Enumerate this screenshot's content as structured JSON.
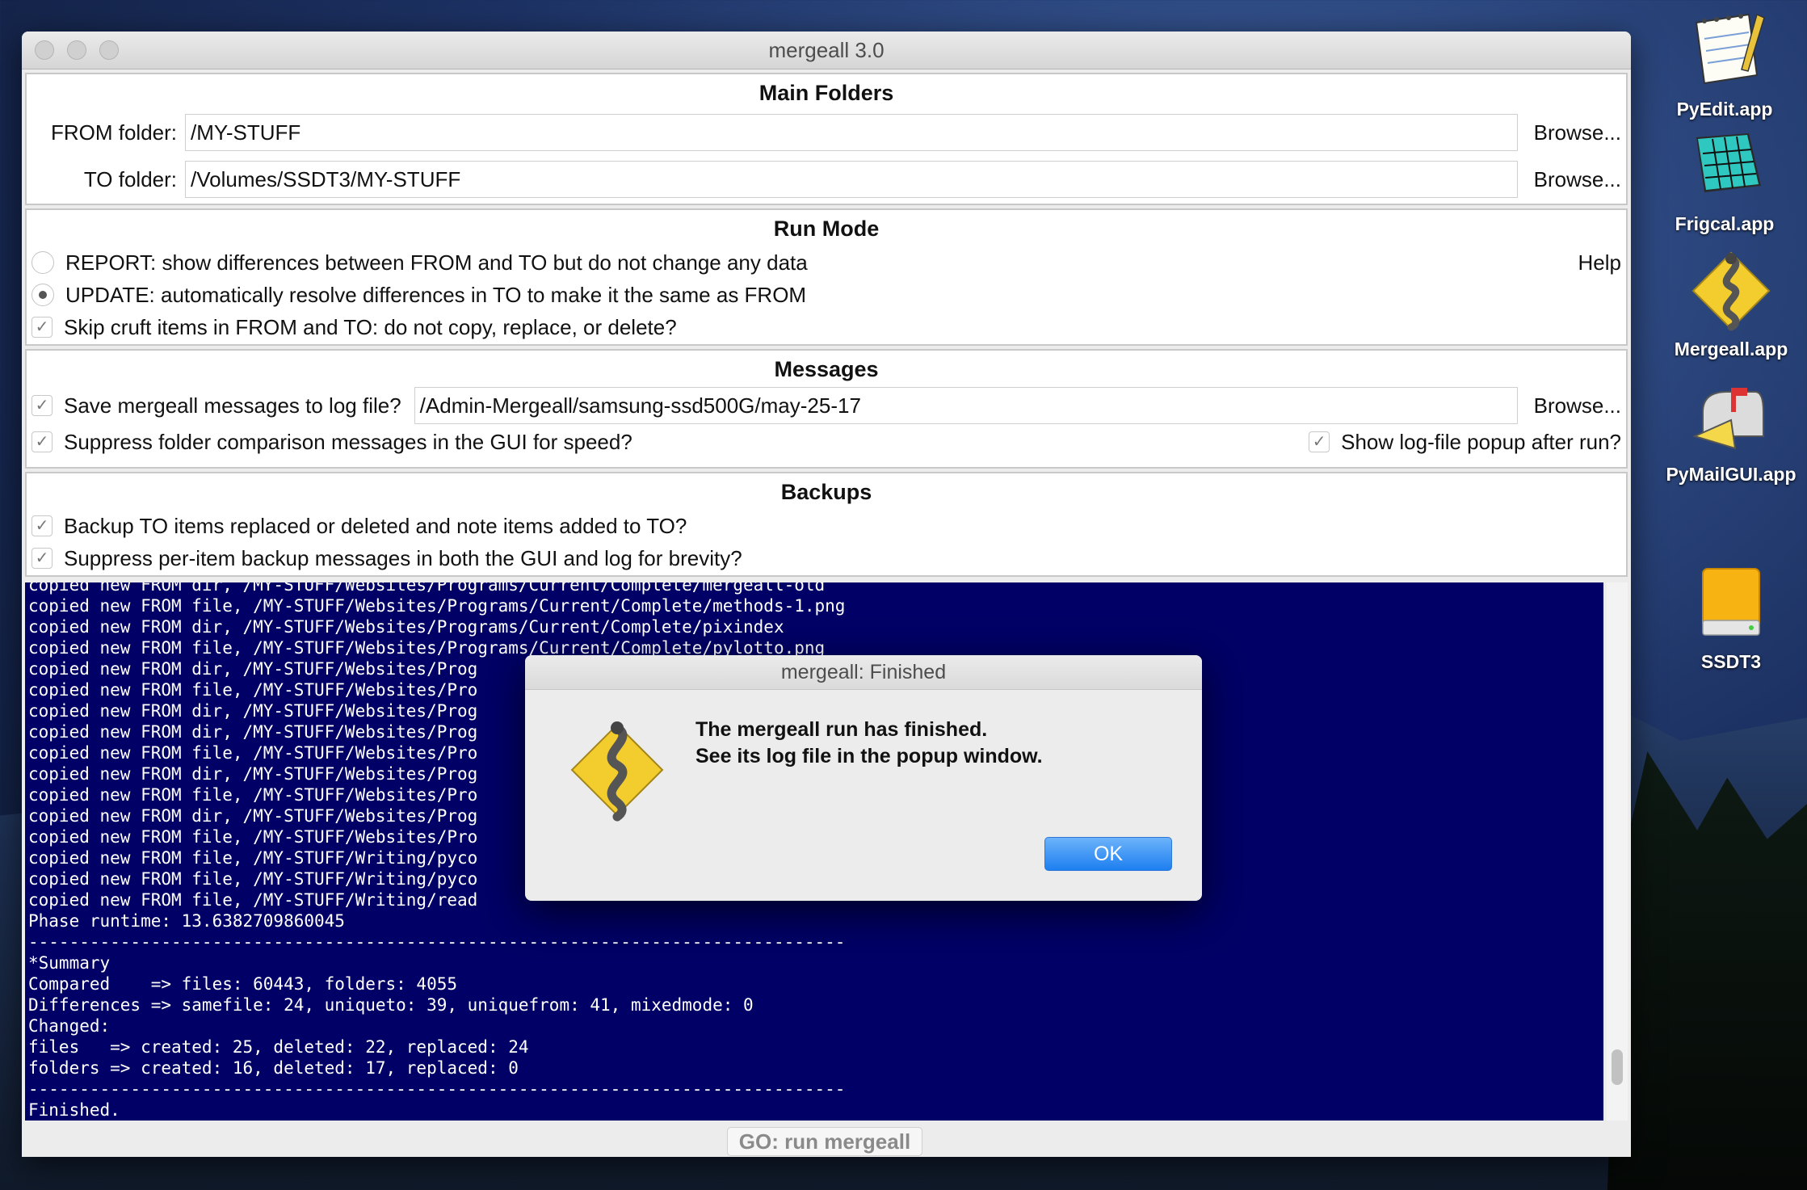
{
  "window": {
    "title": "mergeall 3.0",
    "main_folders": {
      "heading": "Main Folders",
      "from_label": "FROM folder:",
      "from_value": "/MY-STUFF",
      "to_label": "TO folder:",
      "to_value": "/Volumes/SSDT3/MY-STUFF",
      "browse_label": "Browse..."
    },
    "run_mode": {
      "heading": "Run Mode",
      "report_label": "REPORT: show differences between FROM and TO but do not change any data",
      "update_label": "UPDATE: automatically resolve differences in TO to make it the same as FROM",
      "skip_label": "Skip cruft items in FROM and TO: do not copy, replace, or delete?",
      "help_label": "Help",
      "selected": "UPDATE"
    },
    "messages": {
      "heading": "Messages",
      "save_log_label": "Save mergeall messages to log file?",
      "log_path": "/Admin-Mergeall/samsung-ssd500G/may-25-17",
      "browse_label": "Browse...",
      "suppress_label": "Suppress folder comparison messages in the GUI for speed?",
      "show_popup_label": "Show log-file popup after run?"
    },
    "backups": {
      "heading": "Backups",
      "backup_label": "Backup TO items replaced or deleted and note items added to TO?",
      "suppress_backup_label": "Suppress per-item backup messages in both the GUI and log for brevity?"
    },
    "log_lines": [
      "copied new FROM dir, /MY-STUFF/Websites/Programs/Current/Complete/mergeall-old",
      "copied new FROM file, /MY-STUFF/Websites/Programs/Current/Complete/methods-1.png",
      "copied new FROM dir, /MY-STUFF/Websites/Programs/Current/Complete/pixindex",
      "copied new FROM file, /MY-STUFF/Websites/Programs/Current/Complete/pylotto.png",
      "copied new FROM dir, /MY-STUFF/Websites/Prog",
      "copied new FROM file, /MY-STUFF/Websites/Pro",
      "copied new FROM dir, /MY-STUFF/Websites/Prog",
      "copied new FROM dir, /MY-STUFF/Websites/Prog",
      "copied new FROM file, /MY-STUFF/Websites/Pro",
      "copied new FROM dir, /MY-STUFF/Websites/Prog",
      "copied new FROM file, /MY-STUFF/Websites/Pro",
      "copied new FROM dir, /MY-STUFF/Websites/Prog",
      "copied new FROM file, /MY-STUFF/Websites/Pro",
      "copied new FROM file, /MY-STUFF/Writing/pyco",
      "copied new FROM file, /MY-STUFF/Writing/pyco",
      "copied new FROM file, /MY-STUFF/Writing/read",
      "Phase runtime: 13.6382709860045",
      "--------------------------------------------------------------------------------",
      "*Summary",
      "Compared    => files: 60443, folders: 4055",
      "Differences => samefile: 24, uniqueto: 39, uniquefrom: 41, mixedmode: 0",
      "Changed:",
      "files   => created: 25, deleted: 22, replaced: 24",
      "folders => created: 16, deleted: 17, replaced: 0",
      "--------------------------------------------------------------------------------",
      "Finished."
    ],
    "go_label": "GO: run mergeall"
  },
  "dialog": {
    "title": "mergeall: Finished",
    "line1": "The mergeall run has finished.",
    "line2": "See its log file in the popup window.",
    "ok_label": "OK"
  },
  "desktop_icons": [
    {
      "label": "PyEdit.app",
      "icon": "notepad-icon"
    },
    {
      "label": "Frigcal.app",
      "icon": "calendar-icon"
    },
    {
      "label": "Mergeall.app",
      "icon": "snake-icon"
    },
    {
      "label": "PyMailGUI.app",
      "icon": "mailbox-icon"
    },
    {
      "label": "SSDT3",
      "icon": "drive-icon"
    }
  ]
}
